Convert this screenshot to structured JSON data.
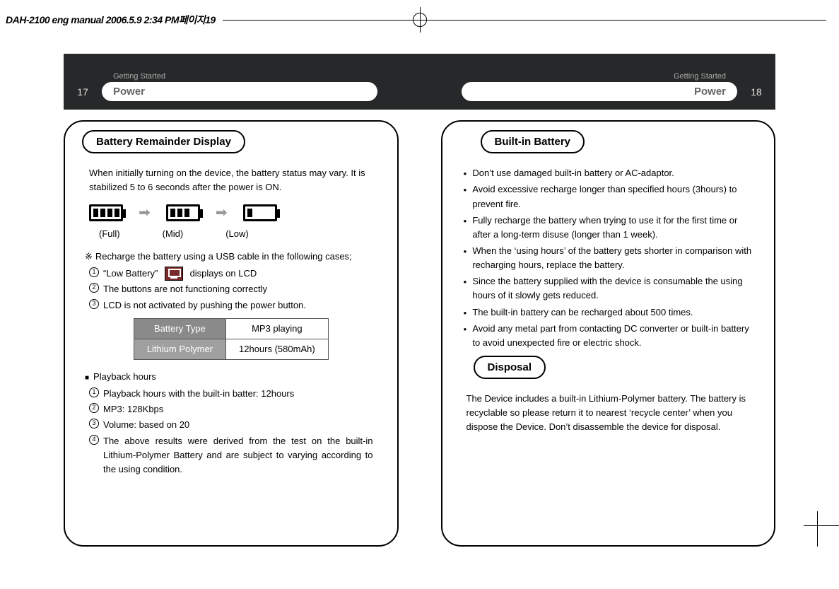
{
  "print_header": "DAH-2100 eng manual  2006.5.9 2:34 PM페이지19",
  "band": {
    "left_page_num": "17",
    "right_page_num": "18",
    "section_small": "Getting Started",
    "section_title": "Power"
  },
  "left_panel": {
    "heading": "Battery Remainder Display",
    "intro": "When initially turning on the device, the battery status may vary. It is stabilized 5 to 6 seconds after the power is ON.",
    "battery_labels": {
      "full": "(Full)",
      "mid": "(Mid)",
      "low": "(Low)"
    },
    "recharge_note": "Recharge the battery using a USB cable in the following cases;",
    "recharge_cases": [
      {
        "prefix": "“Low Battery”",
        "suffix": "displays on LCD"
      },
      {
        "text": "The buttons are not functioning correctly"
      },
      {
        "text": "LCD is not activated by pushing the power button."
      }
    ],
    "spec_table": {
      "h1": "Battery Type",
      "h2": "MP3 playing",
      "r1": "Lithium Polymer",
      "r2": "12hours (580mAh)"
    },
    "playback_title": "Playback hours",
    "playback_items": [
      "Playback hours with the built-in batter: 12hours",
      "MP3: 128Kbps",
      "Volume: based on 20",
      "The above results were derived from the test on the built-in Lithium-Polymer Battery and are subject to varying according to the using condition."
    ]
  },
  "right_panel": {
    "heading1": "Built-in Battery",
    "bullets": [
      "Don’t use damaged built-in battery or AC-adaptor.",
      "Avoid excessive recharge longer than specified hours (3hours) to prevent fire.",
      "Fully recharge the battery when trying to use it for the first time or after a long-term disuse (longer than 1 week).",
      "When the ‘using hours’ of the battery gets shorter in comparison with recharging hours, replace the battery.",
      "Since the battery supplied with the device is consumable the using hours of it slowly gets reduced.",
      "The built-in battery can be recharged about 500 times.",
      "Avoid any metal part from contacting DC converter or built-in battery to avoid unexpected fire or electric shock."
    ],
    "heading2": "Disposal",
    "disposal_text": "The Device includes a built-in Lithium-Polymer battery. The battery is recyclable so please return it to nearest ‘recycle center’ when you dispose the Device. Don’t disassemble the device for disposal."
  }
}
